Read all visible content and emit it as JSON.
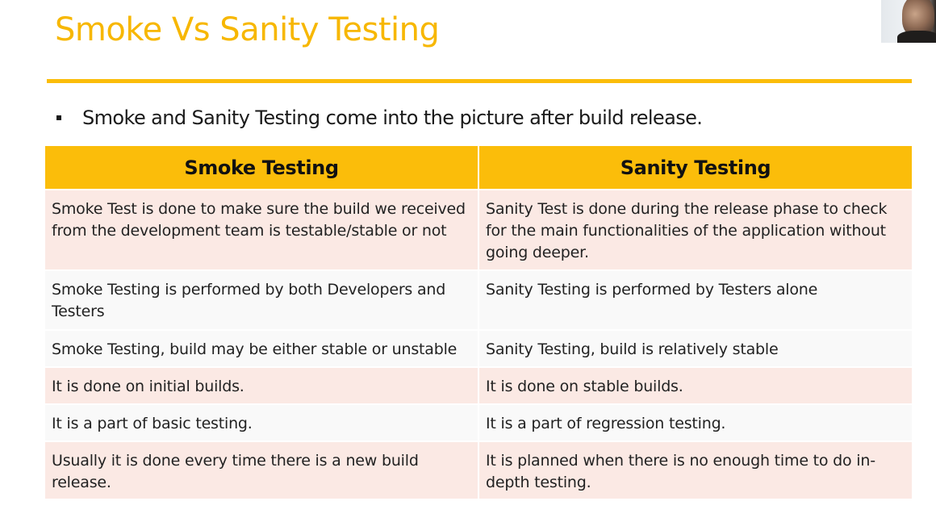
{
  "slide": {
    "title": "Smoke Vs Sanity Testing",
    "bullet": "Smoke and Sanity Testing come into the picture after build release."
  },
  "table": {
    "headers": [
      "Smoke Testing",
      "Sanity Testing"
    ],
    "rows": [
      [
        "Smoke Test is done to make sure the build we received from the development team is testable/stable or not",
        "Sanity Test is done during the release phase to check for the main functionalities of the application without going deeper."
      ],
      [
        "Smoke Testing is performed by both Developers and Testers",
        "Sanity Testing is performed by Testers alone"
      ],
      [
        "Smoke Testing, build may be either stable or unstable",
        "Sanity Testing, build is relatively stable"
      ],
      [
        "It is done on initial builds.",
        "It is done on stable builds."
      ],
      [
        "It is a part of basic testing.",
        "It is a part of regression testing."
      ],
      [
        "Usually it is done every time there is a new build release.",
        "It is planned when there is no enough time to do in-depth testing."
      ]
    ]
  },
  "colors": {
    "accent": "#fbbd0a",
    "title": "#f7b700",
    "row_pink": "#fbe9e4",
    "row_grey": "#f9f9f9"
  }
}
